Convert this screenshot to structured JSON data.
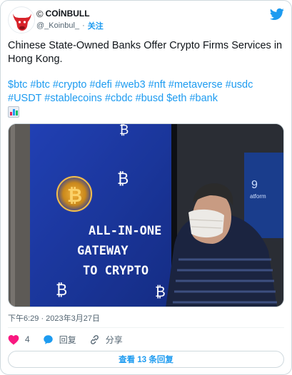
{
  "author": {
    "name_prefix": "©",
    "name": "COİNBULL",
    "handle": "@_Koinbul_",
    "separator": "·",
    "follow_label": "关注"
  },
  "tweet": {
    "text": "Chinese State-Owned Banks Offer Crypto Firms Services in Hong Kong.",
    "hashtags_line1": "$btc #btc #crypto #defi #web3 #nft #metaverse #usdc",
    "hashtags_line2": "#USDT #stablecoins #cbdc #busd $eth #bank",
    "emoji": "bar-chart-emoji"
  },
  "photo": {
    "screen_lines": [
      "ALL-IN-ONE",
      "GATEWAY",
      "TO CRYPTO"
    ],
    "btc_symbol": "₿",
    "side_sign": "atform",
    "side_number": "9"
  },
  "timestamp": "下午6:29 · 2023年3月27日",
  "actions": {
    "like_count": "4",
    "reply_label": "回复",
    "share_label": "分享"
  },
  "replies_button": "查看 13 条回复",
  "colors": {
    "accent": "#1d9bf0",
    "like": "#f91880",
    "text": "#0f1419",
    "muted": "#536471",
    "screen_blue": "#1e3aa8"
  },
  "icons": {
    "logo": "bull-logo-icon",
    "twitter": "twitter-bird-icon",
    "like": "heart-icon",
    "reply": "speech-bubble-icon",
    "share": "link-icon"
  }
}
